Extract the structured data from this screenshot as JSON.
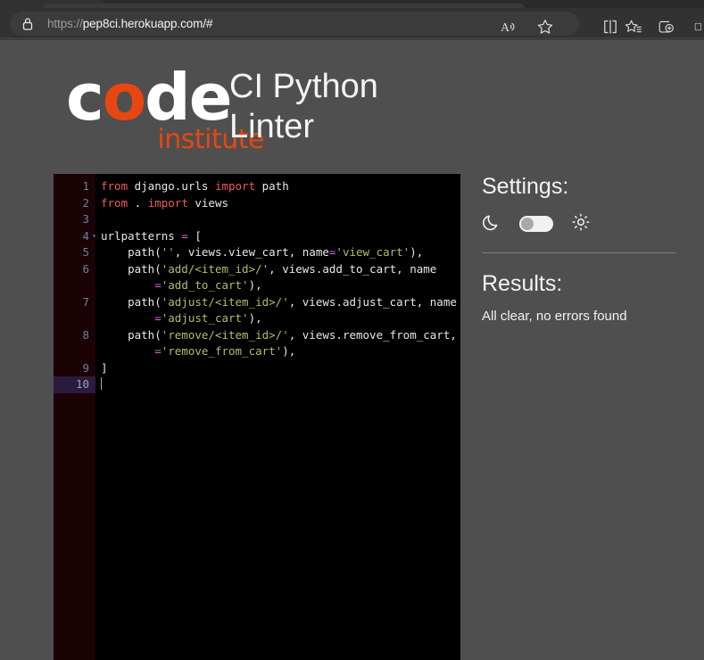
{
  "browser": {
    "url_scheme": "https://",
    "url_rest": "pep8ci.herokuapp.com/#",
    "lock_icon": "lock-icon",
    "toolbar_icons": [
      {
        "name": "read-aloud-icon"
      },
      {
        "name": "favorite-star-icon"
      },
      {
        "name": "split-screen-icon"
      },
      {
        "name": "collections-star-icon"
      },
      {
        "name": "add-to-collections-icon"
      },
      {
        "name": "overflow-icon"
      }
    ]
  },
  "header": {
    "logo_code": "cod",
    "logo_code_o": "o",
    "logo_code_pre": "c",
    "logo_code_post": "de",
    "logo_sub": "institute",
    "app_title": "CI Python Linter"
  },
  "editor": {
    "language": "python",
    "lines": [
      {
        "number": "1",
        "tokens": [
          {
            "t": "from",
            "c": "kw"
          },
          {
            "t": " django.urls ",
            "c": "pl"
          },
          {
            "t": "import",
            "c": "kw"
          },
          {
            "t": " path",
            "c": "pl"
          }
        ]
      },
      {
        "number": "2",
        "tokens": [
          {
            "t": "from",
            "c": "kw"
          },
          {
            "t": " . ",
            "c": "pl"
          },
          {
            "t": "import",
            "c": "kw"
          },
          {
            "t": " views",
            "c": "pl"
          }
        ]
      },
      {
        "number": "3",
        "tokens": []
      },
      {
        "number": "4",
        "fold": true,
        "tokens": [
          {
            "t": "urlpatterns ",
            "c": "pl"
          },
          {
            "t": "=",
            "c": "op"
          },
          {
            "t": " [",
            "c": "pl"
          }
        ]
      },
      {
        "number": "5",
        "tokens": [
          {
            "t": "    path(",
            "c": "pl"
          },
          {
            "t": "''",
            "c": "str"
          },
          {
            "t": ", views.view_cart, name",
            "c": "pl"
          },
          {
            "t": "=",
            "c": "op"
          },
          {
            "t": "'view_cart'",
            "c": "str"
          },
          {
            "t": "),",
            "c": "pl"
          }
        ]
      },
      {
        "number": "6",
        "wrapped": true,
        "tokens": [
          {
            "t": "    path(",
            "c": "pl"
          },
          {
            "t": "'add/<item_id>/'",
            "c": "str"
          },
          {
            "t": ", views.add_to_cart, name",
            "c": "pl"
          },
          {
            "t": "\n        ",
            "c": "pl"
          },
          {
            "t": "=",
            "c": "op"
          },
          {
            "t": "'add_to_cart'",
            "c": "str"
          },
          {
            "t": "),",
            "c": "pl"
          }
        ]
      },
      {
        "number": "7",
        "wrapped": true,
        "tokens": [
          {
            "t": "    path(",
            "c": "pl"
          },
          {
            "t": "'adjust/<item_id>/'",
            "c": "str"
          },
          {
            "t": ", views.adjust_cart, name",
            "c": "pl"
          },
          {
            "t": "\n        ",
            "c": "pl"
          },
          {
            "t": "=",
            "c": "op"
          },
          {
            "t": "'adjust_cart'",
            "c": "str"
          },
          {
            "t": "),",
            "c": "pl"
          }
        ]
      },
      {
        "number": "8",
        "wrapped": true,
        "tokens": [
          {
            "t": "    path(",
            "c": "pl"
          },
          {
            "t": "'remove/<item_id>/'",
            "c": "str"
          },
          {
            "t": ", views.remove_from_cart, name",
            "c": "pl"
          },
          {
            "t": "\n        ",
            "c": "pl"
          },
          {
            "t": "=",
            "c": "op"
          },
          {
            "t": "'remove_from_cart'",
            "c": "str"
          },
          {
            "t": "),",
            "c": "pl"
          }
        ]
      },
      {
        "number": "9",
        "tokens": [
          {
            "t": "]",
            "c": "pl"
          }
        ]
      },
      {
        "number": "10",
        "active": true,
        "cursor": true,
        "tokens": []
      }
    ]
  },
  "side_panel": {
    "settings_heading": "Settings:",
    "dark_icon": "moon-icon",
    "light_icon": "sun-icon",
    "theme_toggle_state": "dark",
    "results_heading": "Results:",
    "results_text": "All clear, no errors found"
  },
  "colors": {
    "page_bg": "#4f4f4f",
    "chrome_bg": "#323232",
    "brand_orange": "#e84610",
    "editor_bg": "#000000",
    "gutter_bg": "#1b0305",
    "keyword": "#f05a5a",
    "string": "#b5bd68",
    "operator": "#d96ad9"
  }
}
